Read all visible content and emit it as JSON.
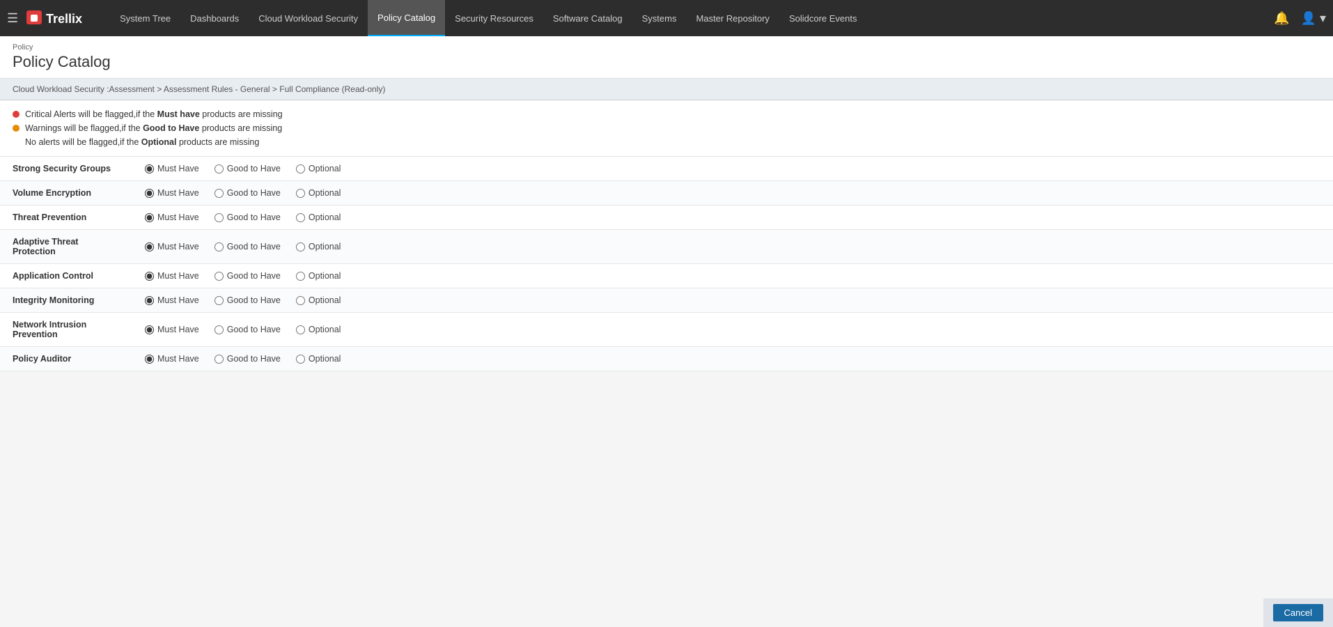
{
  "app": {
    "hamburger_label": "☰",
    "logo_text": "Trellix"
  },
  "nav": {
    "links": [
      {
        "label": "System Tree",
        "active": false
      },
      {
        "label": "Dashboards",
        "active": false
      },
      {
        "label": "Cloud Workload Security",
        "active": false
      },
      {
        "label": "Policy Catalog",
        "active": true
      },
      {
        "label": "Security Resources",
        "active": false
      },
      {
        "label": "Software Catalog",
        "active": false
      },
      {
        "label": "Systems",
        "active": false
      },
      {
        "label": "Master Repository",
        "active": false
      },
      {
        "label": "Solidcore Events",
        "active": false
      }
    ]
  },
  "page_header": {
    "sub": "Policy",
    "title": "Policy Catalog"
  },
  "breadcrumb": "Cloud Workload Security :Assessment > Assessment Rules - General > Full Compliance (Read-only)",
  "notices": [
    {
      "dot": "red",
      "text_before": "Critical Alerts will be flagged,if the ",
      "bold": "Must have",
      "text_after": " products are missing"
    },
    {
      "dot": "orange",
      "text_before": "Warnings will be flagged,if the ",
      "bold": "Good to Have",
      "text_after": " products are missing"
    },
    {
      "dot": "none",
      "text_before": "No alerts will be flagged,if the ",
      "bold": "Optional",
      "text_after": " products are missing"
    }
  ],
  "policy_rows": [
    {
      "name": "Strong Security Groups",
      "selected": "must"
    },
    {
      "name": "Volume Encryption",
      "selected": "must"
    },
    {
      "name": "Threat Prevention",
      "selected": "must"
    },
    {
      "name": "Adaptive Threat Protection",
      "selected": "must"
    },
    {
      "name": "Application Control",
      "selected": "must"
    },
    {
      "name": "Integrity Monitoring",
      "selected": "must"
    },
    {
      "name": "Network Intrusion Prevention",
      "selected": "must"
    },
    {
      "name": "Policy Auditor",
      "selected": "must"
    }
  ],
  "radio_options": [
    {
      "label": "Must Have",
      "value": "must"
    },
    {
      "label": "Good to Have",
      "value": "good"
    },
    {
      "label": "Optional",
      "value": "optional"
    }
  ],
  "footer": {
    "cancel_label": "Cancel"
  }
}
